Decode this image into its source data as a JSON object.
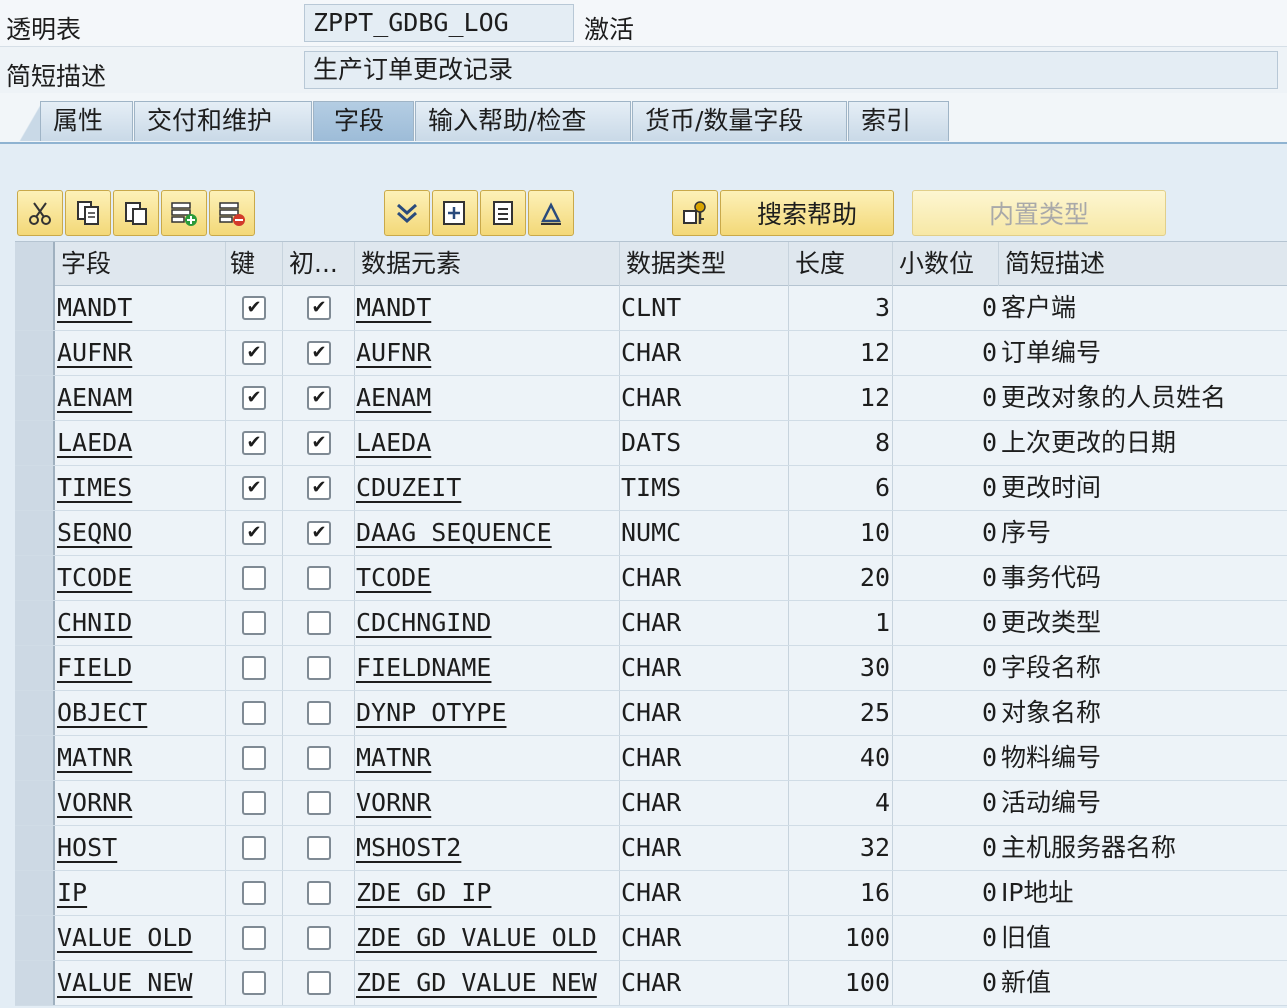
{
  "header": {
    "table_label": "透明表",
    "table_name": "ZPPT_GDBG_LOG",
    "status": "激活",
    "desc_label": "简短描述",
    "description": "生产订单更改记录"
  },
  "tabs": [
    {
      "label": "属性",
      "active": false
    },
    {
      "label": "交付和维护",
      "active": false
    },
    {
      "label": "字段",
      "active": true
    },
    {
      "label": "输入帮助/检查",
      "active": false
    },
    {
      "label": "货币/数量字段",
      "active": false
    },
    {
      "label": "索引",
      "active": false
    }
  ],
  "toolbar": {
    "search_help_label": "搜索帮助",
    "builtin_type_label": "内置类型"
  },
  "columns": [
    "字段",
    "键",
    "初...",
    "数据元素",
    "数据类型",
    "长度",
    "小数位",
    "简短描述"
  ],
  "rows": [
    {
      "field": "MANDT",
      "key": true,
      "init": true,
      "element": "MANDT",
      "type": "CLNT",
      "length": "3",
      "decimals": "0",
      "desc": "客户端"
    },
    {
      "field": "AUFNR",
      "key": true,
      "init": true,
      "element": "AUFNR",
      "type": "CHAR",
      "length": "12",
      "decimals": "0",
      "desc": "订单编号"
    },
    {
      "field": "AENAM",
      "key": true,
      "init": true,
      "element": "AENAM",
      "type": "CHAR",
      "length": "12",
      "decimals": "0",
      "desc": "更改对象的人员姓名"
    },
    {
      "field": "LAEDA",
      "key": true,
      "init": true,
      "element": "LAEDA",
      "type": "DATS",
      "length": "8",
      "decimals": "0",
      "desc": "上次更改的日期"
    },
    {
      "field": "TIMES",
      "key": true,
      "init": true,
      "element": "CDUZEIT",
      "type": "TIMS",
      "length": "6",
      "decimals": "0",
      "desc": "更改时间"
    },
    {
      "field": "SEQNO",
      "key": true,
      "init": true,
      "element": "DAAG_SEQUENCE",
      "type": "NUMC",
      "length": "10",
      "decimals": "0",
      "desc": "序号"
    },
    {
      "field": "TCODE",
      "key": false,
      "init": false,
      "element": "TCODE",
      "type": "CHAR",
      "length": "20",
      "decimals": "0",
      "desc": "事务代码"
    },
    {
      "field": "CHNID",
      "key": false,
      "init": false,
      "element": "CDCHNGIND",
      "type": "CHAR",
      "length": "1",
      "decimals": "0",
      "desc": "更改类型"
    },
    {
      "field": "FIELD",
      "key": false,
      "init": false,
      "element": "FIELDNAME",
      "type": "CHAR",
      "length": "30",
      "decimals": "0",
      "desc": "字段名称"
    },
    {
      "field": "OBJECT",
      "key": false,
      "init": false,
      "element": "DYNP_OTYPE",
      "type": "CHAR",
      "length": "25",
      "decimals": "0",
      "desc": "对象名称"
    },
    {
      "field": "MATNR",
      "key": false,
      "init": false,
      "element": "MATNR",
      "type": "CHAR",
      "length": "40",
      "decimals": "0",
      "desc": "物料编号"
    },
    {
      "field": "VORNR",
      "key": false,
      "init": false,
      "element": "VORNR",
      "type": "CHAR",
      "length": "4",
      "decimals": "0",
      "desc": "活动编号"
    },
    {
      "field": "HOST",
      "key": false,
      "init": false,
      "element": "MSHOST2",
      "type": "CHAR",
      "length": "32",
      "decimals": "0",
      "desc": "主机服务器名称"
    },
    {
      "field": "IP",
      "key": false,
      "init": false,
      "element": "ZDE_GD_IP",
      "type": "CHAR",
      "length": "16",
      "decimals": "0",
      "desc": "IP地址"
    },
    {
      "field": "VALUE_OLD",
      "key": false,
      "init": false,
      "element": "ZDE_GD_VALUE_OLD",
      "type": "CHAR",
      "length": "100",
      "decimals": "0",
      "desc": "旧值"
    },
    {
      "field": "VALUE_NEW",
      "key": false,
      "init": false,
      "element": "ZDE_GD_VALUE_NEW",
      "type": "CHAR",
      "length": "100",
      "decimals": "0",
      "desc": "新值"
    }
  ]
}
